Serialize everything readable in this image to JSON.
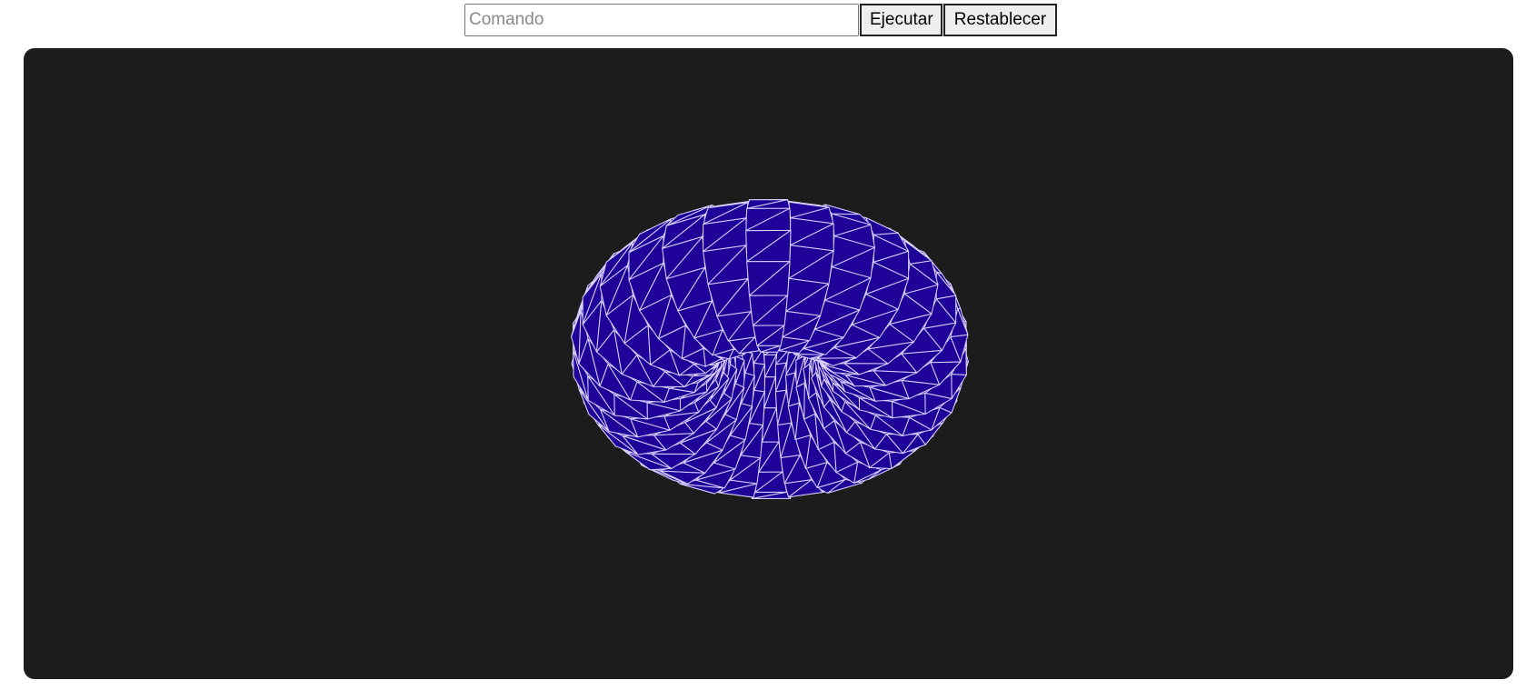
{
  "command_bar": {
    "input_placeholder": "Comando",
    "input_value": "",
    "execute_label": "Ejecutar",
    "reset_label": "Restablecer"
  },
  "scene": {
    "background_color": "#1c1c1c",
    "object": "torus",
    "render_mode": "wireframe-over-solid",
    "fill_color": "#1f0399",
    "wire_color": "#d9d2ff"
  }
}
